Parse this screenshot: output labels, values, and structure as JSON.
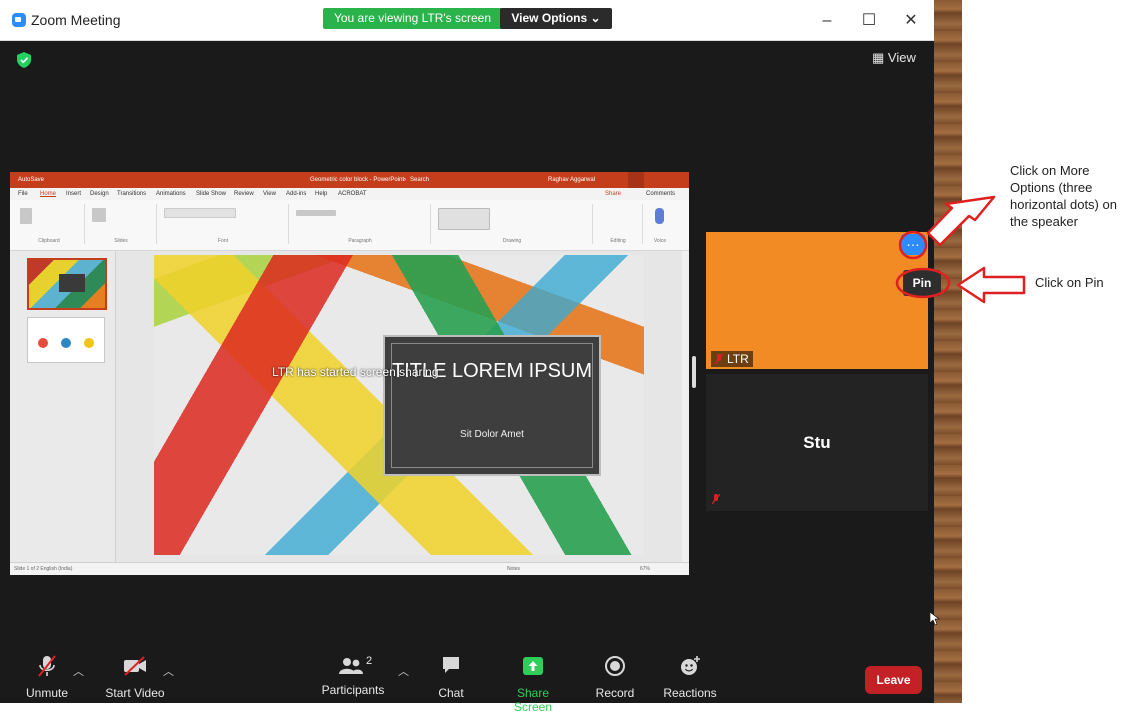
{
  "window": {
    "title": "Zoom Meeting",
    "viewing_banner": "You are viewing LTR's screen",
    "view_options_label": "View Options",
    "view_button_label": "View"
  },
  "shared_screen": {
    "ppt_title": "Geometric color block - PowerPoint",
    "ppt_user": "Raghav Aggarwal",
    "ppt_autosave": "AutoSave",
    "ppt_search": "Search",
    "ppt_menu": [
      "File",
      "Home",
      "Insert",
      "Design",
      "Transitions",
      "Animations",
      "Slide Show",
      "Review",
      "View",
      "Add-ins",
      "Help",
      "ACROBAT"
    ],
    "ppt_share": "Share",
    "ppt_comments": "Comments",
    "ribbon_groups": [
      "Clipboard",
      "Slides",
      "Font",
      "Paragraph",
      "Drawing",
      "Editing",
      "Voice"
    ],
    "started_sharing": "LTR has started screen sharing",
    "slide_title": "TITLE LOREM IPSUM",
    "slide_subtitle": "Sit Dolor Amet",
    "status_left": "Slide 1 of 2    English (India)",
    "status_notes": "Notes",
    "status_zoom": "67%"
  },
  "participants": [
    {
      "name": "LTR",
      "tile_color": "#f28b24",
      "muted": true
    },
    {
      "name": "Stu",
      "tile_color": "#232323",
      "muted": true
    }
  ],
  "pin_label": "Pin",
  "annotations": {
    "more_options": "Click on More Options (three horizontal dots) on the speaker",
    "pin": "Click on Pin"
  },
  "toolbar": {
    "unmute": "Unmute",
    "start_video": "Start Video",
    "participants": "Participants",
    "participants_count": "2",
    "chat": "Chat",
    "share_screen": "Share Screen",
    "record": "Record",
    "reactions": "Reactions",
    "leave": "Leave"
  },
  "colors": {
    "zoom_blue": "#2d8cff",
    "share_green": "#29b34a",
    "leave_red": "#c32126",
    "annotation_red": "#e02020"
  }
}
